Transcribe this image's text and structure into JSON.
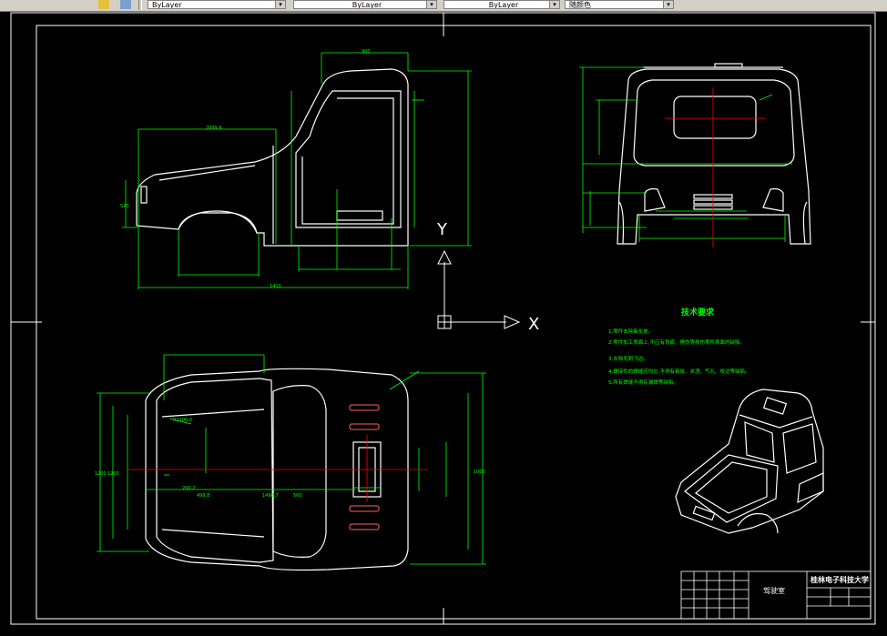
{
  "toolbar": {
    "color_control": "ByLayer",
    "linetype_control": "ByLayer",
    "lineweight_control": "ByLayer",
    "plotstyle_control": "随颜色"
  },
  "icons": [
    "layer-icon",
    "layer-properties-icon"
  ],
  "drawing": {
    "ucs_y_label": "Y",
    "ucs_x_label": "X",
    "tech_title": "技术要求",
    "tech_items": [
      "1.零件去除氧化皮。",
      "2.零件加工表面上,不应有划痕、擦伤等损伤零件表面的缺陷。",
      "3.去除毛刺飞边。",
      "4.焊接件的焊缝应均匀,不得有裂纹、夹渣、气孔、咬边等缺陷。",
      "5.所有焊缝不得有漏焊等缺陷。"
    ],
    "title_block": {
      "part_name": "驾驶室",
      "school": "桂林电子科技大学"
    },
    "dim_labels": {
      "cab_width_top": "900",
      "side_length": "2099.6",
      "left_height": "570",
      "top_length": "1410",
      "plan_len": "1200",
      "plan_left": "1200",
      "plan_small": "300",
      "plan_low1": "499.8",
      "plan_low2": "200.2",
      "plan_low3": "1498.7",
      "plan_low4": "500",
      "plan_r": "R1100.0",
      "plan_mid": "1000"
    }
  },
  "colors": {
    "background": "#000000",
    "drawing_lines": "#ffffff",
    "dimensions": "#00ff00",
    "center_lines": "#ff0000",
    "accent_red": "#ff6060",
    "toolbar": "#d4d0c8"
  }
}
